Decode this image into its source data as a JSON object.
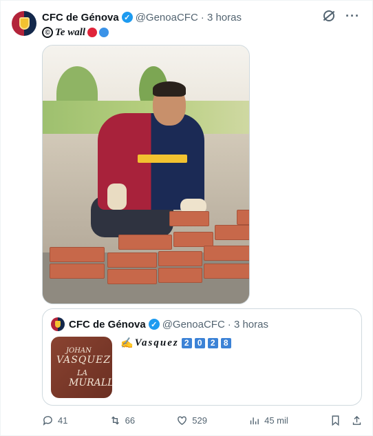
{
  "tweet": {
    "author_name": "CFC de Génova",
    "author_handle": "@GenoaCFC",
    "time": "· 3 horas",
    "text_prefix": "©",
    "text_italic": "Te wall",
    "dot_colors": [
      "#e0243a",
      "#3b93e8"
    ]
  },
  "quote": {
    "author_name": "CFC de Génova",
    "author_handle": "@GenoaCFC",
    "time": "· 3 horas",
    "emoji": "✍️",
    "script_text": "Vasquez",
    "year_digits": [
      "2",
      "0",
      "2",
      "8"
    ],
    "thumb_lines": [
      "JOHAN",
      "VASQUEZ",
      "LA",
      "MURALLA"
    ]
  },
  "actions": {
    "replies": "41",
    "retweets": "66",
    "likes": "529",
    "views": "45 mil"
  },
  "colors": {
    "genoa_red": "#b3243a",
    "genoa_blue": "#14284b",
    "verified": "#1d9bf0"
  }
}
